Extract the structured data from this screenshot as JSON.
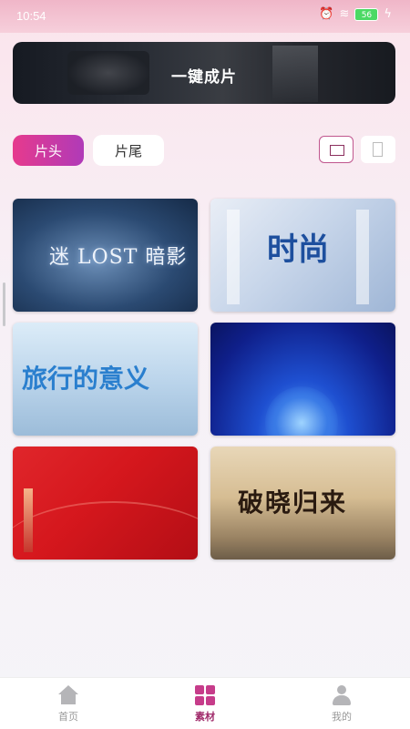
{
  "status_bar": {
    "time": "10:54",
    "battery": "56"
  },
  "banner": {
    "title": "一键成片"
  },
  "tabs": [
    {
      "label": "片头",
      "active": true
    },
    {
      "label": "片尾",
      "active": false
    }
  ],
  "templates": [
    {
      "text": "迷 LOST 暗影"
    },
    {
      "text": "时尚"
    },
    {
      "text": "旅行的意义"
    },
    {
      "text": ""
    },
    {
      "text": ""
    },
    {
      "text": "破晓归来"
    }
  ],
  "bottom_nav": {
    "items": [
      {
        "label": "首页",
        "icon": "home-icon",
        "active": false
      },
      {
        "label": "素材",
        "icon": "grid-icon",
        "active": true
      },
      {
        "label": "我的",
        "icon": "user-icon",
        "active": false
      }
    ]
  },
  "colors": {
    "accent": "#c63c8a",
    "tab_gradient_start": "#e63a8d",
    "tab_gradient_end": "#b03ab8"
  }
}
